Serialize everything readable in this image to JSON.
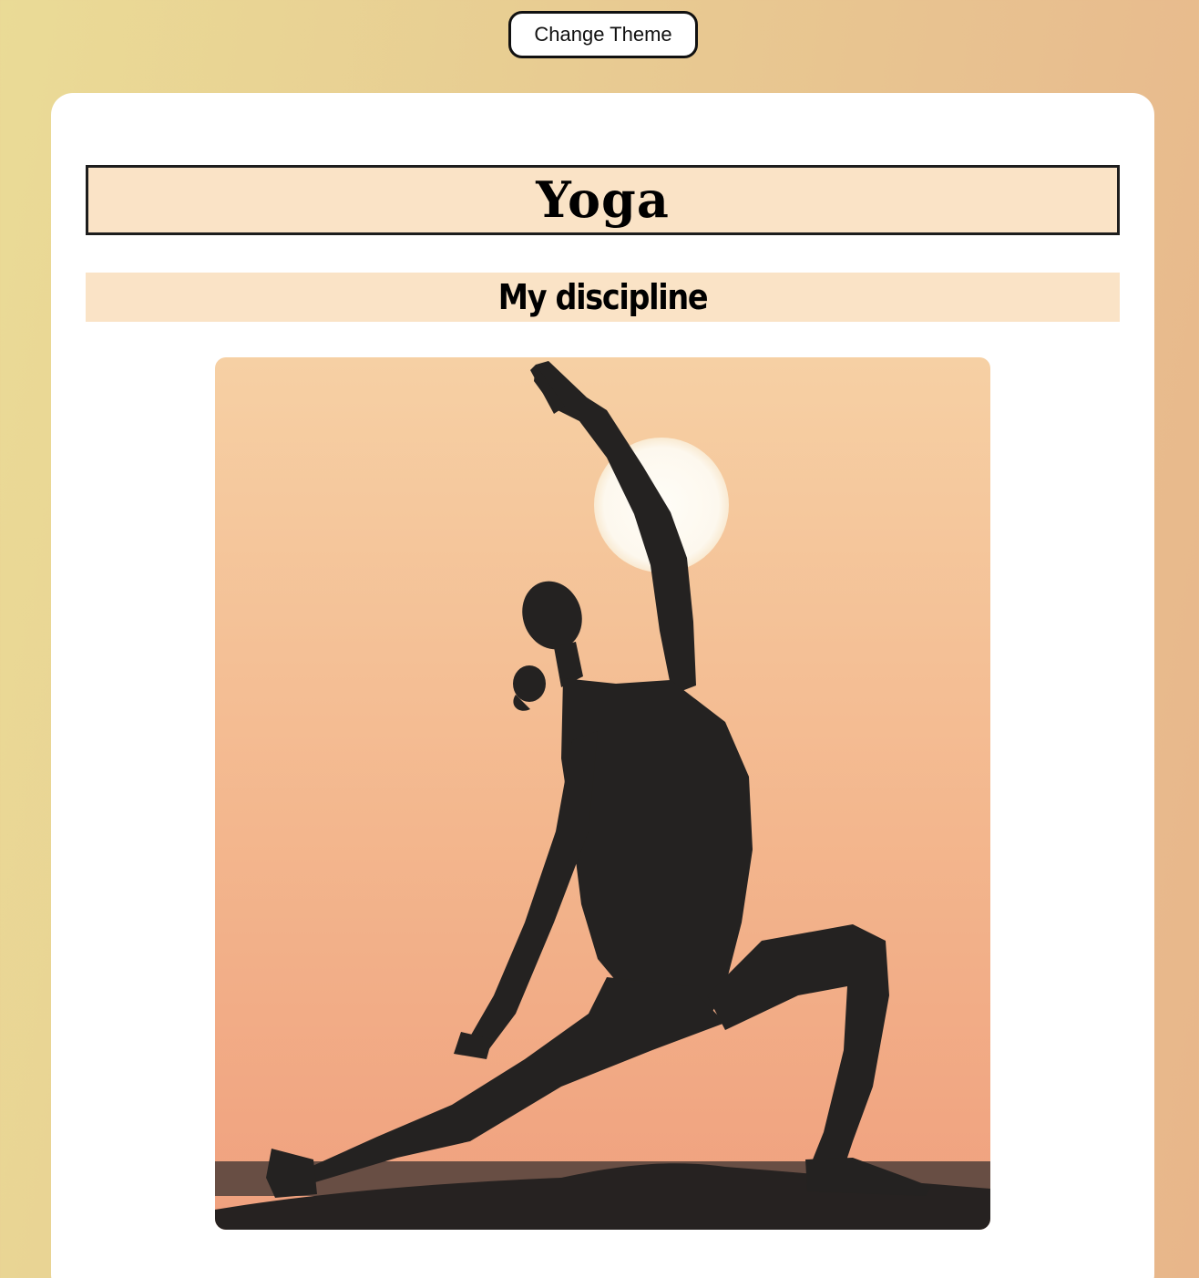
{
  "toolbar": {
    "theme_button_label": "Change Theme"
  },
  "header": {
    "title": "Yoga",
    "subtitle": "My discipline"
  },
  "image": {
    "subject": "woman-silhouette-yoga-pose-sunset",
    "colors": {
      "sky_top": "#f6d0a4",
      "sky_bottom": "#f0a07e",
      "sun": "#fdfaf2",
      "silhouette": "#242221"
    }
  },
  "colors": {
    "heading_background": "#fae3c6",
    "card_background": "#ffffff",
    "page_gradient_start": "#eadb96",
    "page_gradient_end": "#e8b68a"
  }
}
